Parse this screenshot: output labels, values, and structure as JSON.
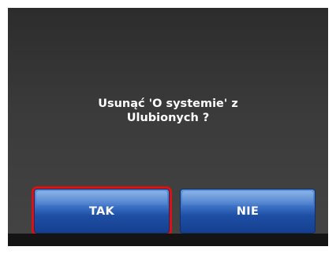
{
  "dialog": {
    "message_line1": "Usunąć 'O systemie' z",
    "message_line2": "Ulubionych ?",
    "yes_label": "TAK",
    "no_label": "NIE",
    "focus_color": "#e01010",
    "button_color": "#2a5db5"
  }
}
